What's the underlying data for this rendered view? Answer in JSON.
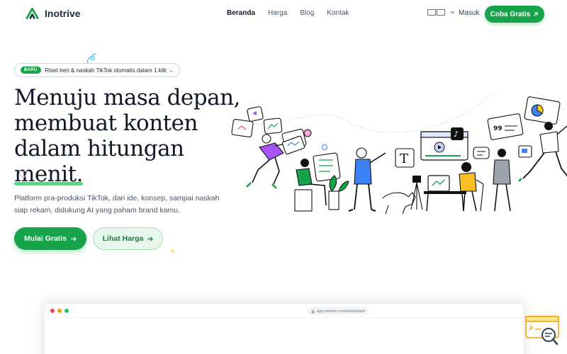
{
  "brand": {
    "name": "Inotrive"
  },
  "nav": {
    "links": [
      "Beranda",
      "Harga",
      "Blog",
      "Kontak"
    ],
    "language_label": "",
    "login": "Masuk",
    "cta": "Coba Gratis",
    "cta_icon": "arrow-up-right-icon"
  },
  "badge": {
    "tag": "BARU",
    "text": "Riset tren & naskah TikTok otomatis dalam 1 klik →"
  },
  "hero": {
    "line1": "Menuju masa depan,",
    "line2": "membuat konten",
    "line3_prefix": "dalam hitungan ",
    "line3_highlight": "menit.",
    "subtitle": "Platform pra-produksi TikTok, dari ide, konsep, sampai naskah siap rekam, didukung AI yang paham brand kamu.",
    "primary_button": "Mulai Gratis",
    "secondary_button": "Lihat Harga"
  },
  "preview": {
    "url": "app.inotrive.com/dashboard"
  },
  "colors": {
    "accent": "#16a34a",
    "highlight": "#4ade80",
    "heading": "#111827"
  }
}
